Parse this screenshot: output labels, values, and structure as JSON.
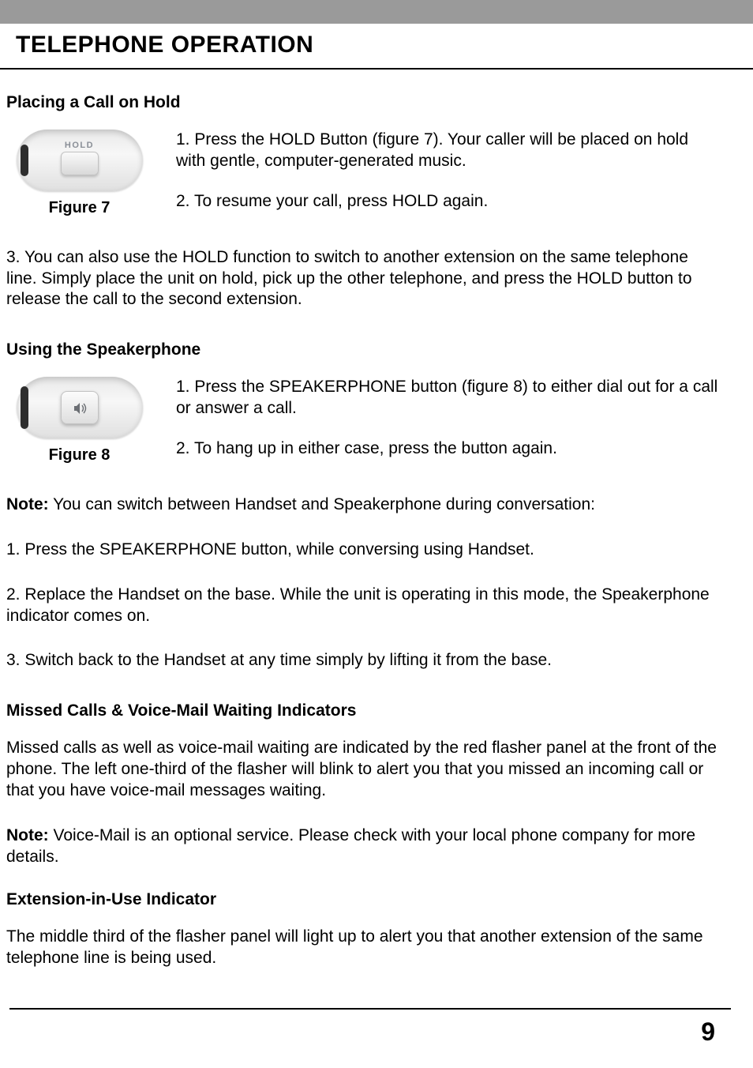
{
  "header": {
    "title": "TELEPHONE OPERATION"
  },
  "sections": {
    "hold": {
      "title": "Placing a Call on Hold",
      "figure_caption": "Figure 7",
      "figure_key_label": "HOLD",
      "step1": "1. Press the HOLD Button (figure 7). Your caller will be placed on hold with gentle, computer-generated music.",
      "step2": "2. To resume your call, press HOLD again.",
      "step3": "3. You can also use the HOLD function to switch to another extension on the same telephone line. Simply place the unit on hold, pick up the other telephone, and press the HOLD button to release the call to the second extension."
    },
    "speaker": {
      "title": "Using the Speakerphone",
      "figure_caption": "Figure 8",
      "step1": "1. Press the SPEAKERPHONE button (figure 8) to either dial out for a call or answer a call.",
      "step2": "2. To hang up in either case, press the button again.",
      "note_prefix": "Note:",
      "note_text": " You can switch between Handset and Speakerphone during conversation:",
      "sw_step1": "1. Press the SPEAKERPHONE button, while conversing using Handset.",
      "sw_step2": "2. Replace the Handset on the base. While the unit is operating in this mode, the Speakerphone indicator comes on.",
      "sw_step3": "3. Switch back to the Handset at any time simply by lifting it from the base."
    },
    "missed": {
      "title": "Missed Calls & Voice-Mail Waiting Indicators",
      "para": "Missed calls as well as voice-mail waiting are indicated by the red flasher panel at the front of the phone. The left one-third of the flasher will blink to alert you that you missed an incoming call or that you have voice-mail messages waiting.",
      "note_prefix": "Note:",
      "note_text": " Voice-Mail is an optional service. Please check with your local phone company for more details."
    },
    "ext": {
      "title": "Extension-in-Use Indicator",
      "para": "The middle third of the flasher panel will light up to alert you that another extension of the same telephone line is being used."
    }
  },
  "footer": {
    "page_number": "9"
  }
}
